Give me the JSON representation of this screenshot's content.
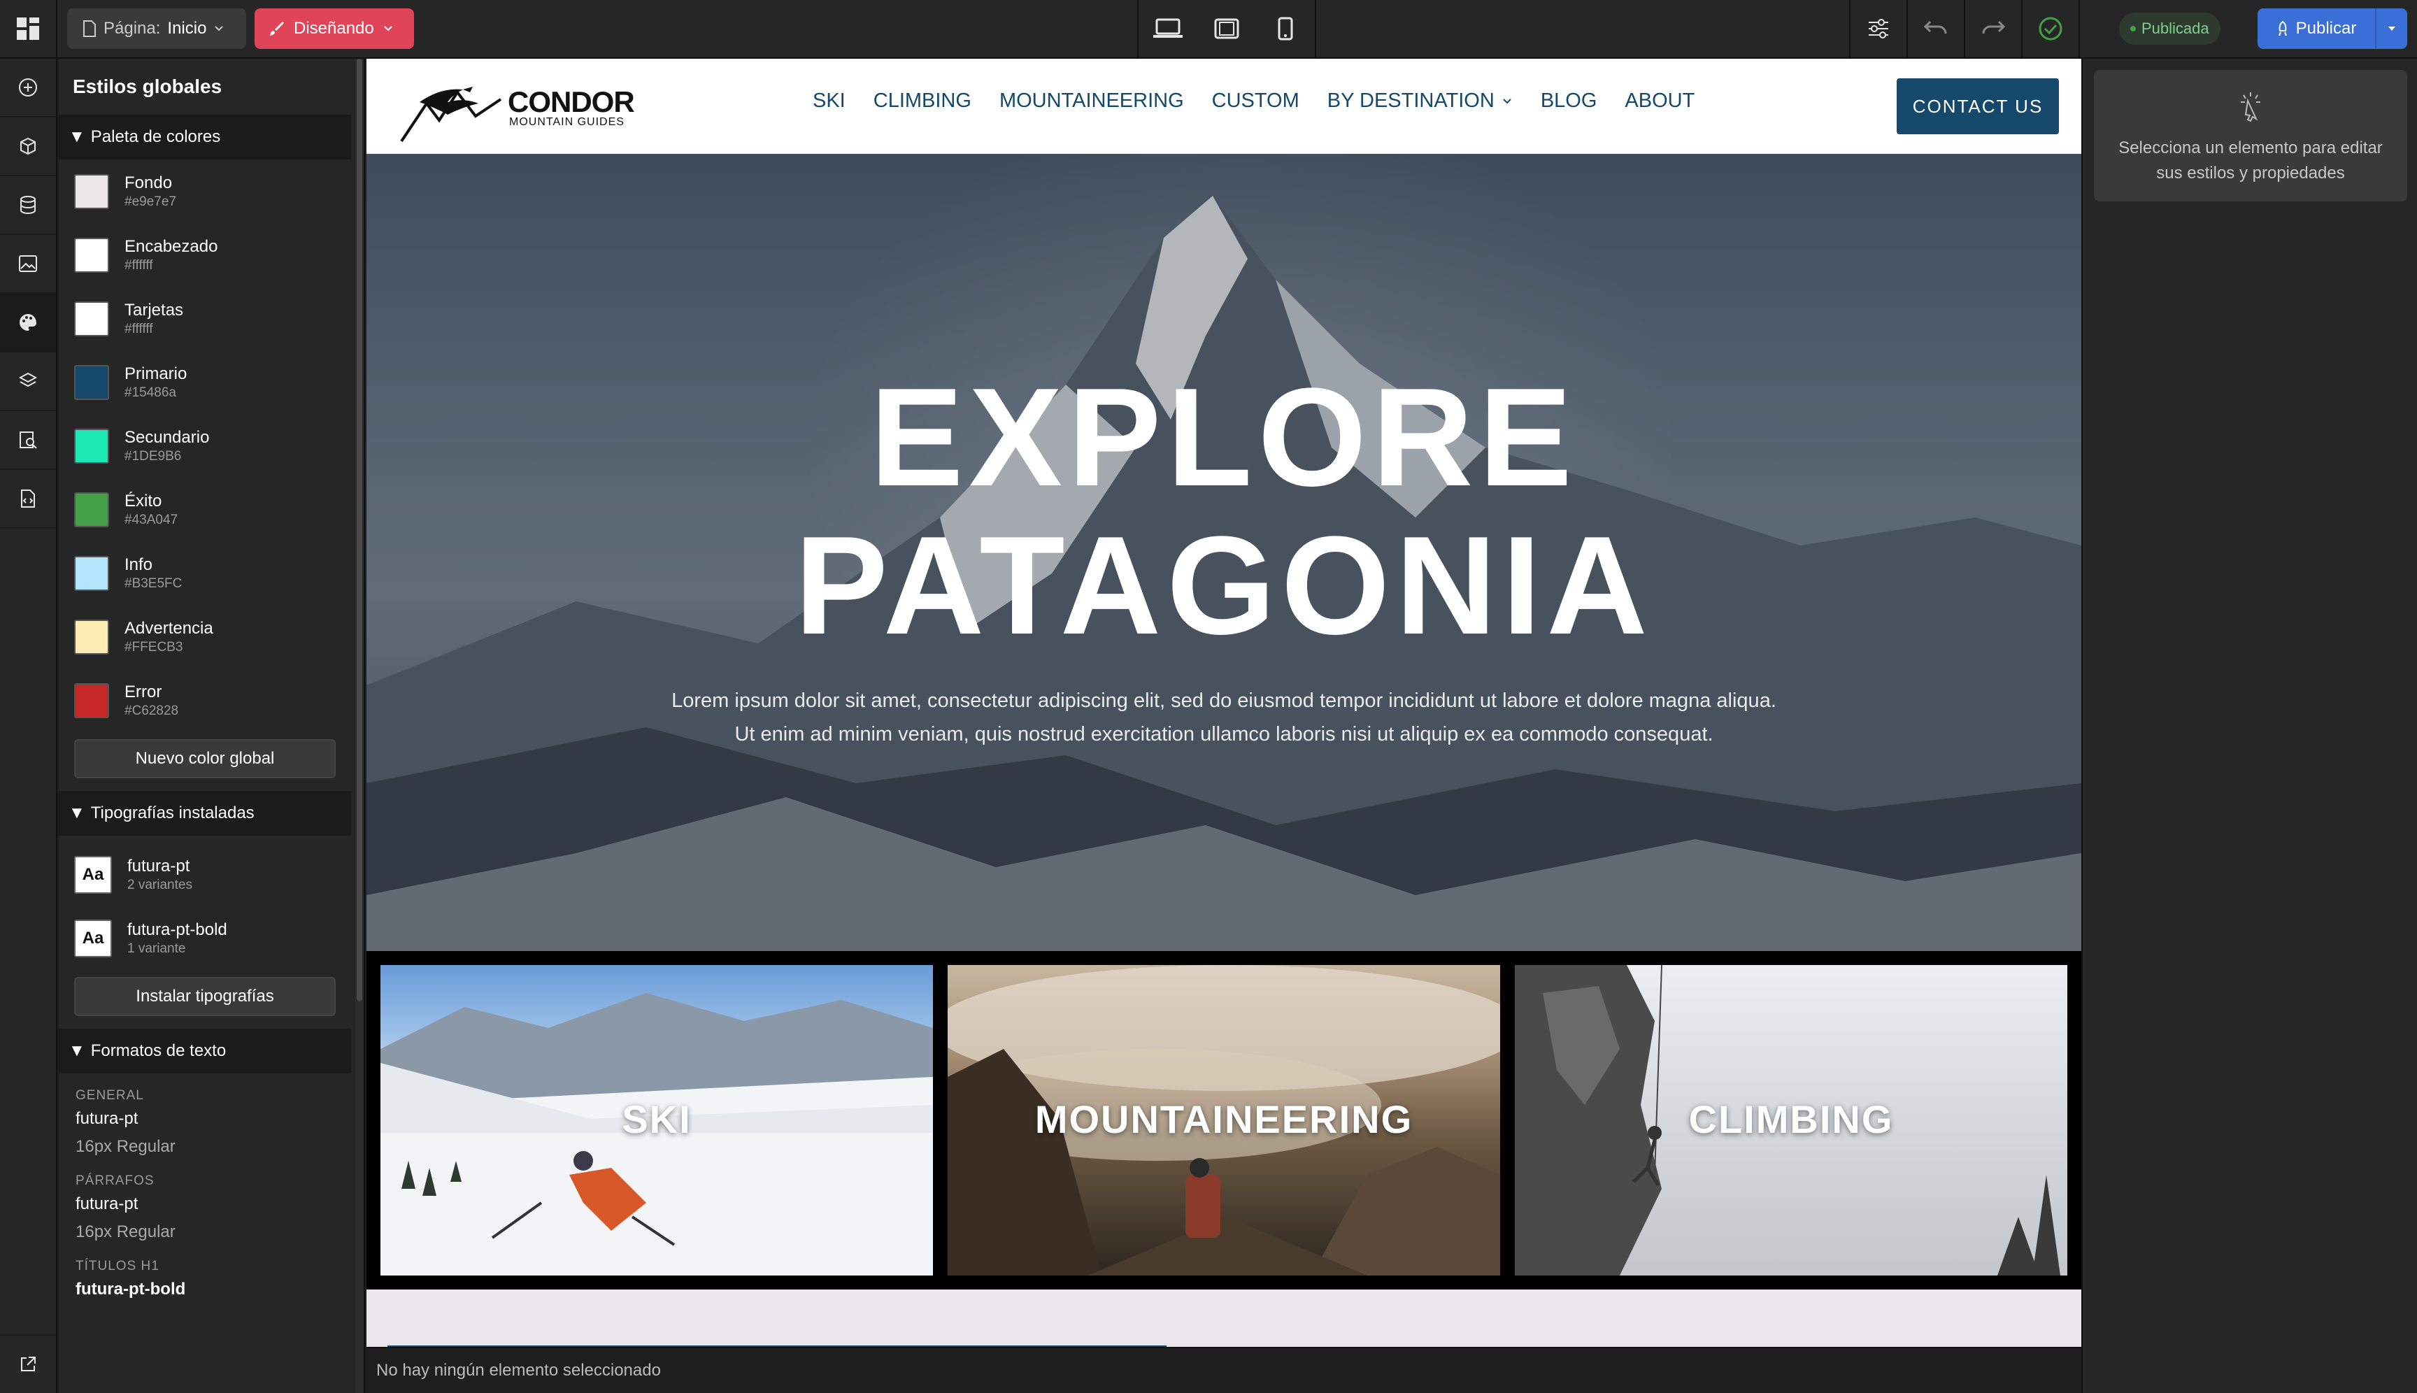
{
  "topbar": {
    "page_prefix": "Página:",
    "page_name": "Inicio",
    "mode_label": "Diseñando",
    "status_label": "Publicada",
    "publish_label": "Publicar"
  },
  "panel": {
    "title": "Estilos globales",
    "palette_title": "Paleta de colores",
    "colors": [
      {
        "name": "Fondo",
        "hex": "#e9e7e7"
      },
      {
        "name": "Encabezado",
        "hex": "#ffffff"
      },
      {
        "name": "Tarjetas",
        "hex": "#ffffff"
      },
      {
        "name": "Primario",
        "hex": "#15486a"
      },
      {
        "name": "Secundario",
        "hex": "#1DE9B6"
      },
      {
        "name": "Éxito",
        "hex": "#43A047"
      },
      {
        "name": "Info",
        "hex": "#B3E5FC"
      },
      {
        "name": "Advertencia",
        "hex": "#FFECB3"
      },
      {
        "name": "Error",
        "hex": "#C62828"
      }
    ],
    "new_color_label": "Nuevo color global",
    "fonts_title": "Tipografías instaladas",
    "fonts": [
      {
        "name": "futura-pt",
        "variants": "2 variantes",
        "icon": "Aa"
      },
      {
        "name": "futura-pt-bold",
        "variants": "1 variante",
        "icon": "Aa"
      }
    ],
    "install_fonts_label": "Instalar tipografías",
    "formats_title": "Formatos de texto",
    "formats": [
      {
        "label": "GENERAL",
        "font": "futura-pt",
        "meta": "16px Regular"
      },
      {
        "label": "PÁRRAFOS",
        "font": "futura-pt",
        "meta": "16px Regular"
      },
      {
        "label": "TÍTULOS H1",
        "font": "futura-pt-bold",
        "meta": ""
      }
    ]
  },
  "site": {
    "brand_name": "CONDOR",
    "brand_sub": "MOUNTAIN GUIDES",
    "nav": [
      "SKI",
      "CLIMBING",
      "MOUNTAINEERING",
      "CUSTOM",
      "BY DESTINATION",
      "BLOG",
      "ABOUT"
    ],
    "contact_label": "CONTACT US",
    "hero_title_line1": "EXPLORE",
    "hero_title_line2": "PATAGONIA",
    "hero_text": "Lorem ipsum dolor sit amet, consectetur adipiscing elit, sed do eiusmod tempor incididunt ut labore et dolore magna aliqua. Ut enim ad minim veniam, quis nostrud exercitation ullamco laboris nisi ut aliquip ex ea commodo consequat.",
    "cards": [
      "SKI",
      "MOUNTAINEERING",
      "CLIMBING"
    ]
  },
  "statusbar": {
    "text": "No hay ningún elemento seleccionado"
  },
  "props": {
    "hint": "Selecciona un elemento para editar sus estilos y propiedades"
  },
  "colors": {
    "accent_publish": "#3a6fd8",
    "accent_design": "#e04458",
    "status_ok": "#43a047",
    "site_primary": "#15486a"
  }
}
